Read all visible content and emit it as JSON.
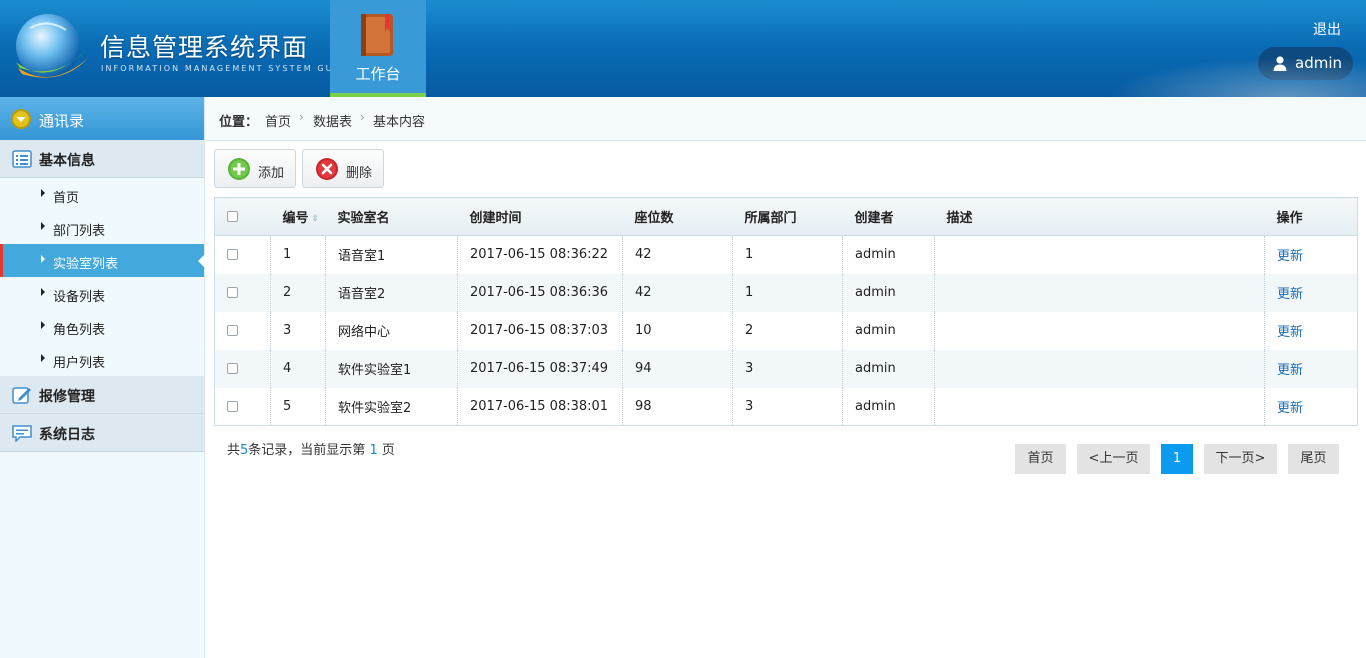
{
  "header": {
    "title": "信息管理系统界面",
    "subtitle": "INFORMATION MANAGEMENT SYSTEM GUI",
    "workbench_label": "工作台",
    "logout_label": "退出",
    "username": "admin"
  },
  "sidebar": {
    "head_label": "通讯录",
    "groups": [
      {
        "label": "基本信息"
      },
      {
        "label": "报修管理"
      },
      {
        "label": "系统日志"
      }
    ],
    "items": [
      {
        "label": "首页"
      },
      {
        "label": "部门列表"
      },
      {
        "label": "实验室列表"
      },
      {
        "label": "设备列表"
      },
      {
        "label": "角色列表"
      },
      {
        "label": "用户列表"
      }
    ]
  },
  "breadcrumb": {
    "label": "位置：",
    "crumbs": [
      "首页",
      "数据表",
      "基本内容"
    ]
  },
  "toolbar": {
    "add_label": "添加",
    "delete_label": "删除"
  },
  "table": {
    "headers": [
      "编号",
      "实验室名",
      "创建时间",
      "座位数",
      "所属部门",
      "创建者",
      "描述",
      "操作"
    ],
    "rows": [
      {
        "id": "1",
        "name": "语音室1",
        "created": "2017-06-15 08:36:22",
        "seats": "42",
        "dept": "1",
        "creator": "admin",
        "desc": "",
        "action": "更新"
      },
      {
        "id": "2",
        "name": "语音室2",
        "created": "2017-06-15 08:36:36",
        "seats": "42",
        "dept": "1",
        "creator": "admin",
        "desc": "",
        "action": "更新"
      },
      {
        "id": "3",
        "name": "网络中心",
        "created": "2017-06-15 08:37:03",
        "seats": "10",
        "dept": "2",
        "creator": "admin",
        "desc": "",
        "action": "更新"
      },
      {
        "id": "4",
        "name": "软件实验室1",
        "created": "2017-06-15 08:37:49",
        "seats": "94",
        "dept": "3",
        "creator": "admin",
        "desc": "",
        "action": "更新"
      },
      {
        "id": "5",
        "name": "软件实验室2",
        "created": "2017-06-15 08:38:01",
        "seats": "98",
        "dept": "3",
        "creator": "admin",
        "desc": "",
        "action": "更新"
      }
    ]
  },
  "summary": {
    "prefix": "共",
    "total": "5",
    "middle": "条记录，当前显示第 ",
    "page": "1",
    "suffix": " 页"
  },
  "pager": {
    "first": "首页",
    "prev": "<上一页",
    "current": "1",
    "next": "下一页>",
    "last": "尾页"
  },
  "colors": {
    "header_blue": "#0a6db6",
    "active_item": "#43a9dd",
    "link": "#196db7",
    "pager_current": "#0a9bf0"
  }
}
